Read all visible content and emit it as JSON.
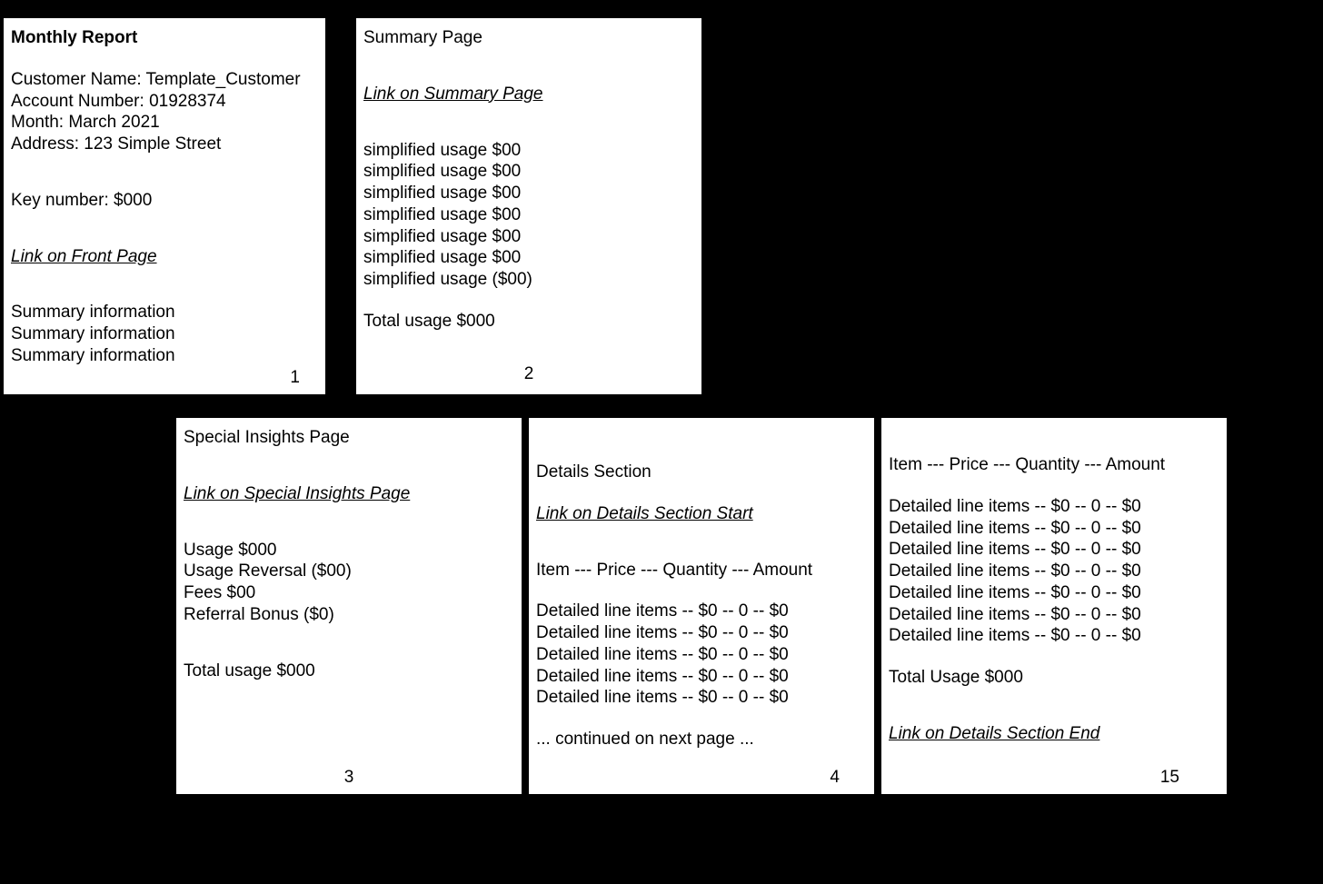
{
  "page1": {
    "title": "Monthly Report",
    "customer_label": "Customer Name: Template_Customer",
    "account_label": "Account Number: 01928374",
    "month_label": "Month: March 2021",
    "address_label": "Address: 123 Simple Street",
    "key_number": "Key number: $000",
    "link": "Link on Front Page",
    "summary": [
      "Summary information",
      "Summary information",
      "Summary information"
    ],
    "num": "1"
  },
  "page2": {
    "title": "Summary Page",
    "link": "Link on Summary Page",
    "usage": [
      "simplified usage $00",
      "simplified usage $00",
      "simplified usage $00",
      "simplified usage $00",
      "simplified usage $00",
      "simplified usage $00",
      "simplified usage ($00)"
    ],
    "total": "Total usage  $000",
    "num": "2"
  },
  "page3": {
    "title": "Special Insights Page",
    "link": "Link on Special Insights Page",
    "lines": [
      "Usage $000",
      "Usage Reversal ($00)",
      "Fees $00",
      "Referral Bonus ($0)"
    ],
    "total": "Total usage  $000",
    "num": "3"
  },
  "page4": {
    "title": "Details Section",
    "link": "Link on Details Section Start",
    "header": "Item --- Price --- Quantity --- Amount",
    "rows": [
      "Detailed line items -- $0 -- 0 -- $0",
      "Detailed line items -- $0 -- 0 -- $0",
      "Detailed line items -- $0 -- 0 -- $0",
      "Detailed line items -- $0 -- 0 -- $0",
      "Detailed line items -- $0 -- 0 -- $0"
    ],
    "continued": "... continued on next page ...",
    "num": "4"
  },
  "page15": {
    "header": "Item --- Price --- Quantity --- Amount",
    "rows": [
      "Detailed line items -- $0 -- 0 -- $0",
      "Detailed line items -- $0 -- 0 -- $0",
      "Detailed line items -- $0 -- 0 -- $0",
      "Detailed line items -- $0 -- 0 -- $0",
      "Detailed line items -- $0 -- 0 -- $0",
      "Detailed line items -- $0 -- 0 -- $0",
      "Detailed line items -- $0 -- 0 -- $0"
    ],
    "total": "Total Usage $000",
    "link": "Link on Details Section End",
    "num": "15"
  }
}
